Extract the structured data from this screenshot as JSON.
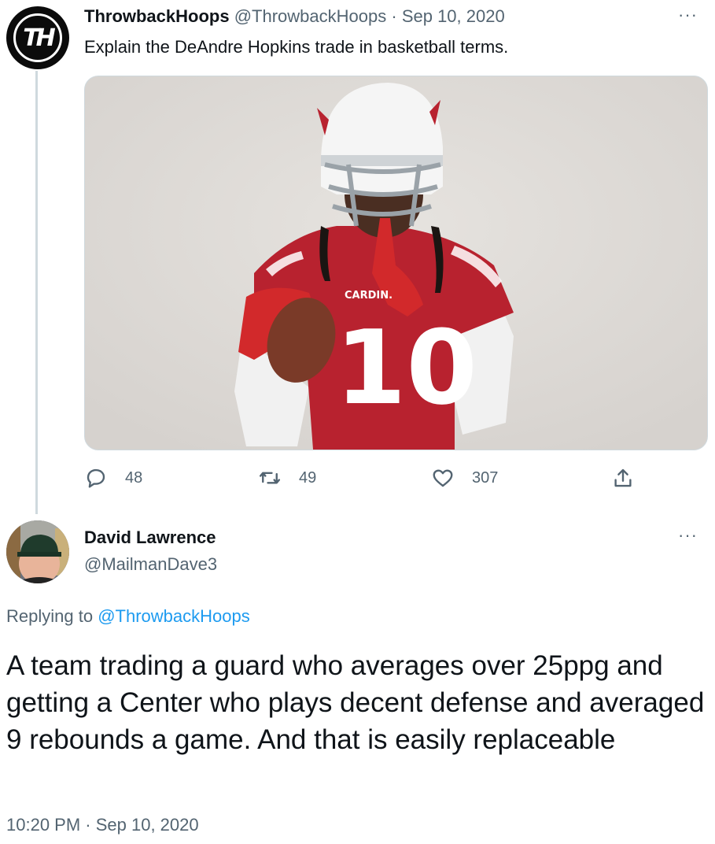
{
  "tweet": {
    "author_name": "ThrowbackHoops",
    "author_handle": "@ThrowbackHoops",
    "separator": "·",
    "date": "Sep 10, 2020",
    "more_label": "···",
    "avatar_logo": "TH",
    "text": "Explain the DeAndre Hopkins trade in basketball terms.",
    "image": {
      "jersey_team": "CARDIN.",
      "jersey_number": "10"
    },
    "actions": {
      "replies": "48",
      "retweets": "49",
      "likes": "307"
    }
  },
  "reply": {
    "author_name": "David Lawrence",
    "author_handle": "@MailmanDave3",
    "more_label": "···",
    "replying_prefix": "Replying to",
    "replying_handle": "@ThrowbackHoops",
    "text": "A team trading a guard who averages over 25ppg and getting a Center who plays decent defense and averaged 9 rebounds a game.  And that is easily replaceable",
    "timestamp": "10:20 PM · Sep 10, 2020"
  },
  "icons": {
    "reply": "comment-icon",
    "retweet": "retweet-icon",
    "like": "heart-icon",
    "share": "share-icon"
  },
  "colors": {
    "text": "#0f1419",
    "secondary": "#536471",
    "link": "#1d9bf0",
    "border": "#cfd9de",
    "jersey_red": "#b8222f"
  }
}
